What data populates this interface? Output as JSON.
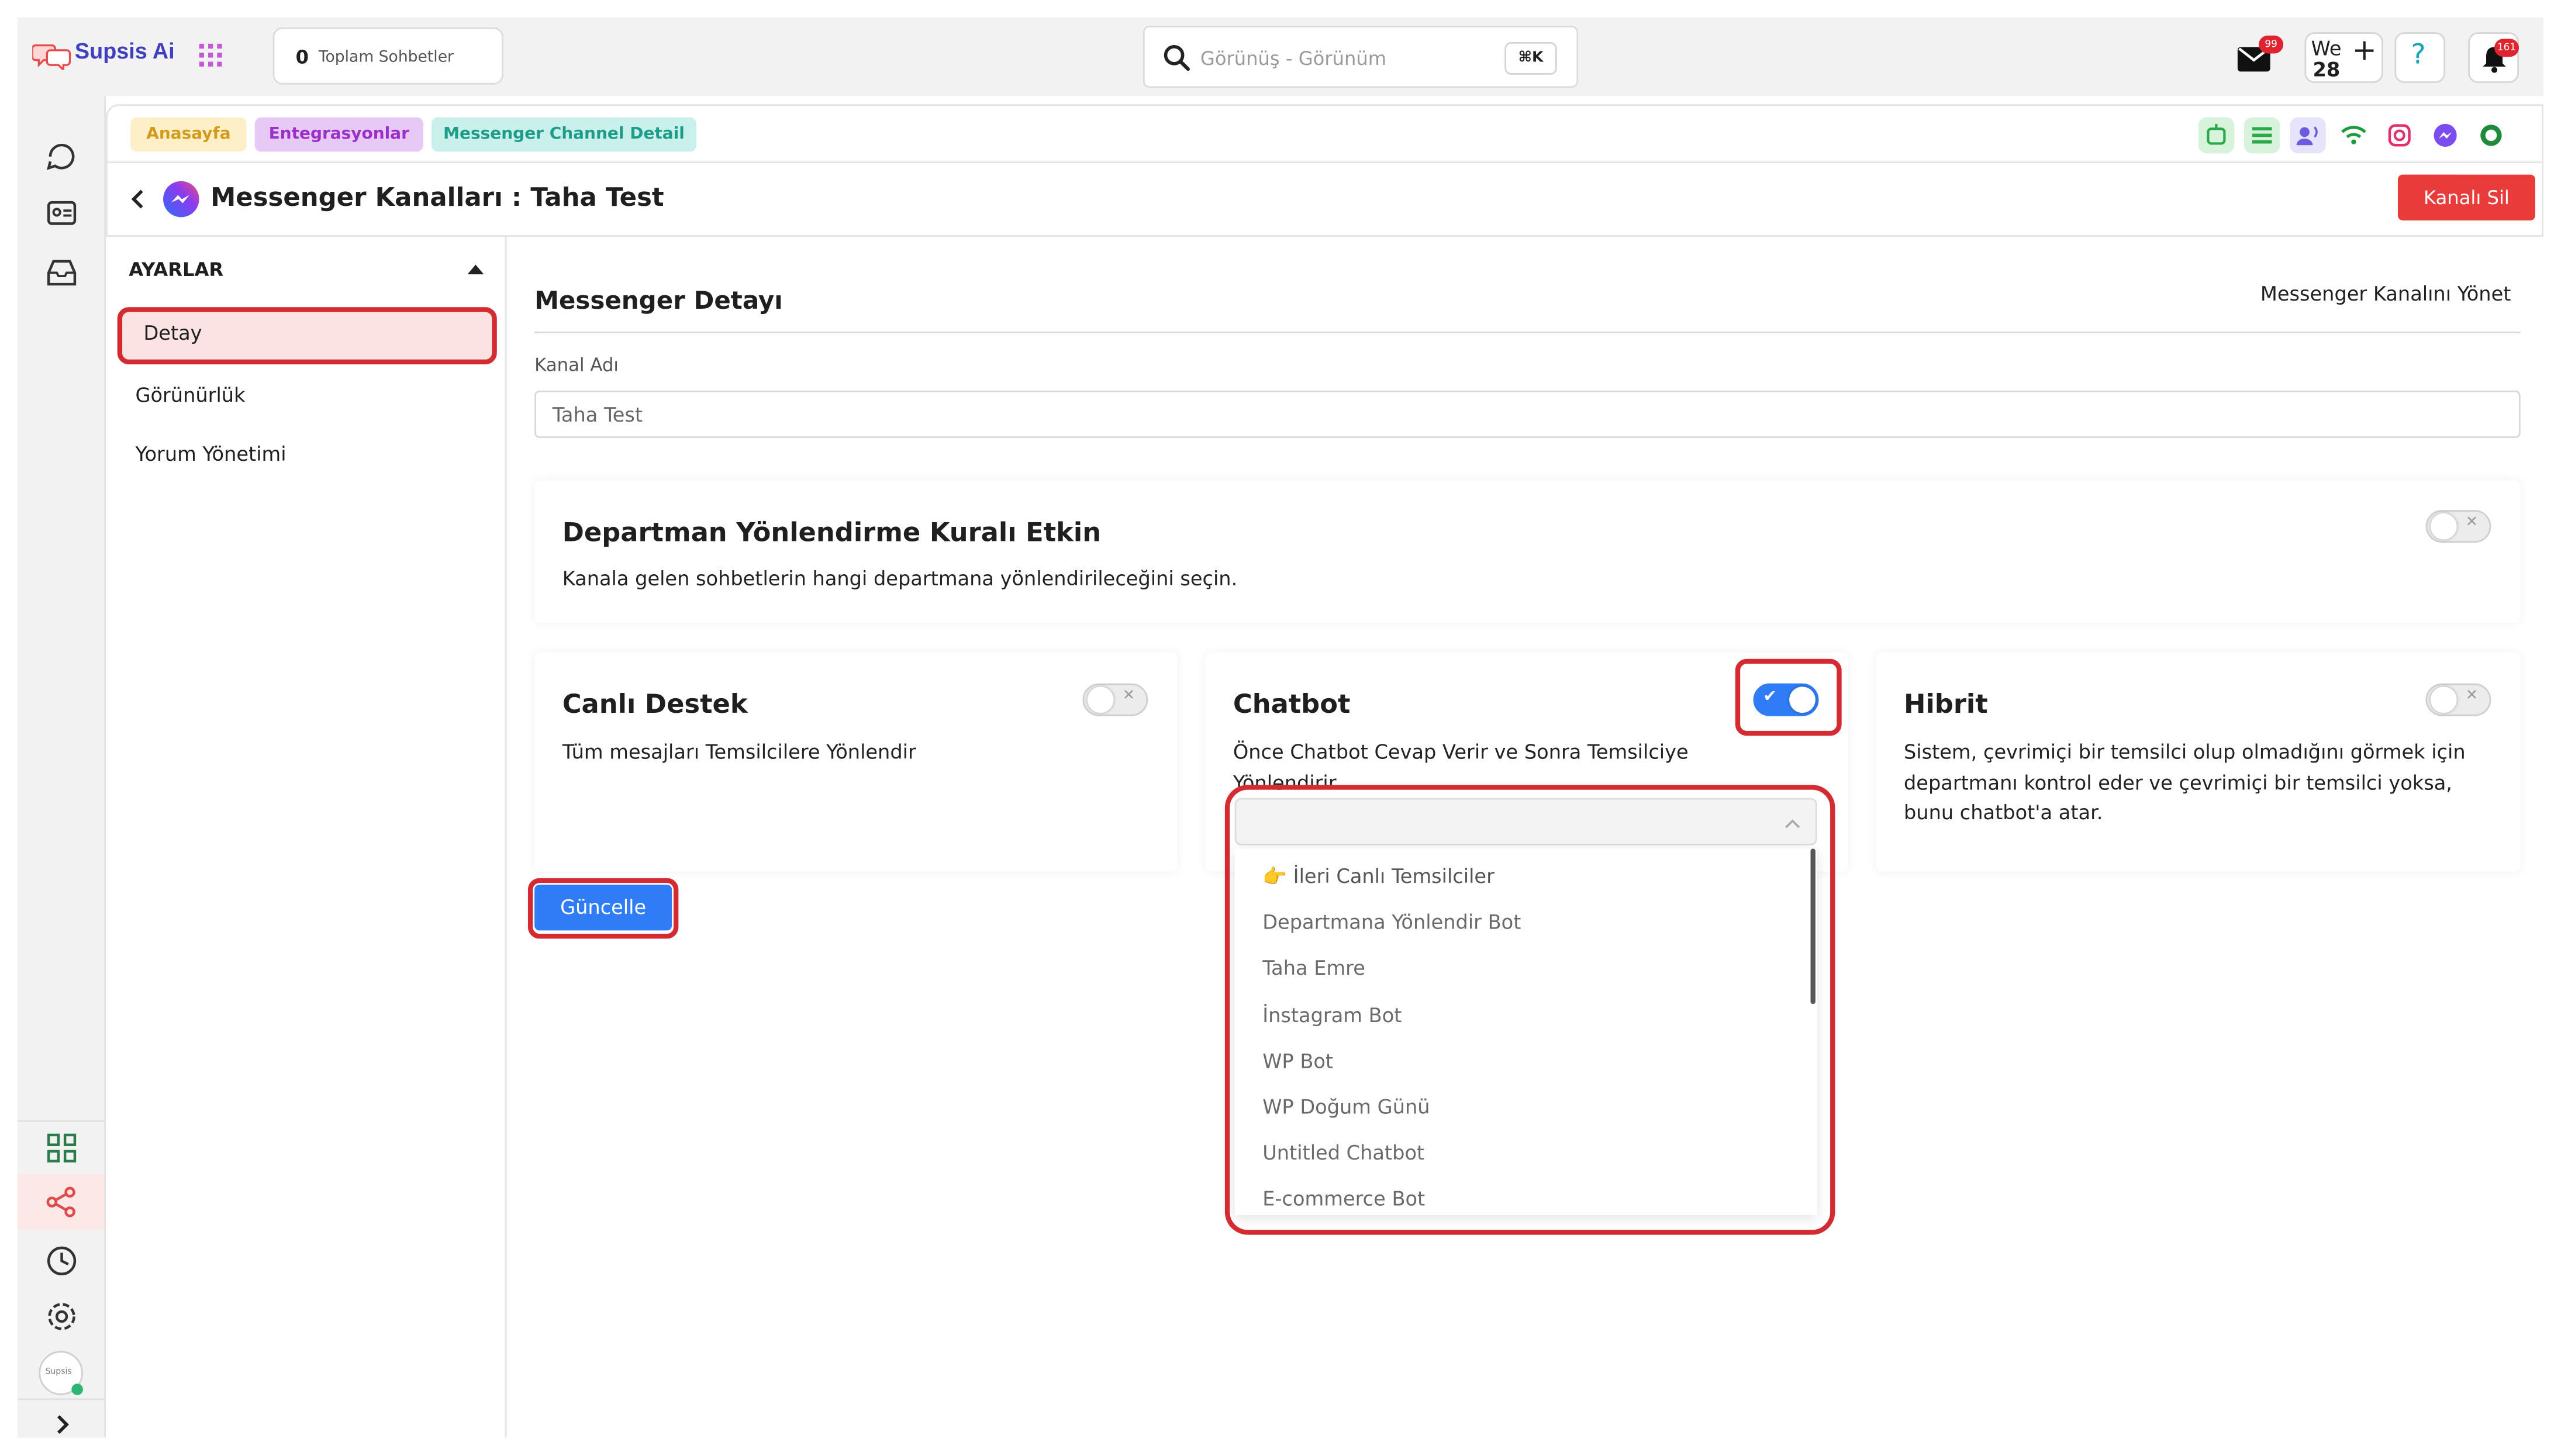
{
  "app": {
    "name": "Supsis Ai"
  },
  "topbar": {
    "total_count": "0",
    "total_label": "Toplam Sohbetler",
    "search_placeholder": "Görünüş - Görünüm",
    "search_shortcut": "⌘K",
    "mail_badge": "99",
    "date_weekday": "We",
    "date_day": "28",
    "help_label": "?",
    "notification_badge": "161"
  },
  "breadcrumbs": [
    {
      "label": "Anasayfa",
      "bg": "#fdf0c8",
      "fg": "#d49a1a"
    },
    {
      "label": "Entegrasyonlar",
      "bg": "#e7c9f5",
      "fg": "#9b2fc9"
    },
    {
      "label": "Messenger Channel Detail",
      "bg": "#c9f0ea",
      "fg": "#1e9c8a"
    }
  ],
  "page": {
    "title": "Messenger Kanalları : Taha Test",
    "delete_button": "Kanalı Sil"
  },
  "settings": {
    "header": "AYARLAR",
    "items": [
      "Detay",
      "Görünürlük",
      "Yorum Yönetimi"
    ],
    "active": "Detay"
  },
  "main": {
    "section_title": "Messenger Detayı",
    "manage_link": "Messenger Kanalını Yönet",
    "channel_name_label": "Kanal Adı",
    "channel_name_value": "Taha Test",
    "department_rule": {
      "title": "Departman Yönlendirme Kuralı Etkin",
      "description": "Kanala gelen sohbetlerin hangi departmana yönlendirileceğini seçin.",
      "enabled": false
    },
    "options": [
      {
        "title": "Canlı Destek",
        "description": "Tüm mesajları Temsilcilere Yönlendir",
        "enabled": false
      },
      {
        "title": "Chatbot",
        "description": "Önce Chatbot Cevap Verir ve Sonra Temsilciye Yönlendirir",
        "enabled": true
      },
      {
        "title": "Hibrit",
        "description": "Sistem, çevrimiçi bir temsilci olup olmadığını görmek için departmanı kontrol eder ve çevrimiçi bir temsilci yoksa, bunu chatbot'a atar.",
        "enabled": false
      }
    ],
    "update_button": "Güncelle",
    "chatbot_dropdown": {
      "selected": "",
      "items": [
        "👉 İleri Canlı Temsilciler",
        "Departmana Yönlendir Bot",
        "Taha Emre",
        "İnstagram Bot",
        "WP Bot",
        "WP Doğum Günü",
        "Untitled Chatbot",
        "E-commerce Bot"
      ]
    }
  },
  "colors": {
    "accent": "#2f7cf6",
    "danger": "#ea3b3b",
    "highlight": "#d42b32",
    "brand": "#3f3fbf"
  }
}
